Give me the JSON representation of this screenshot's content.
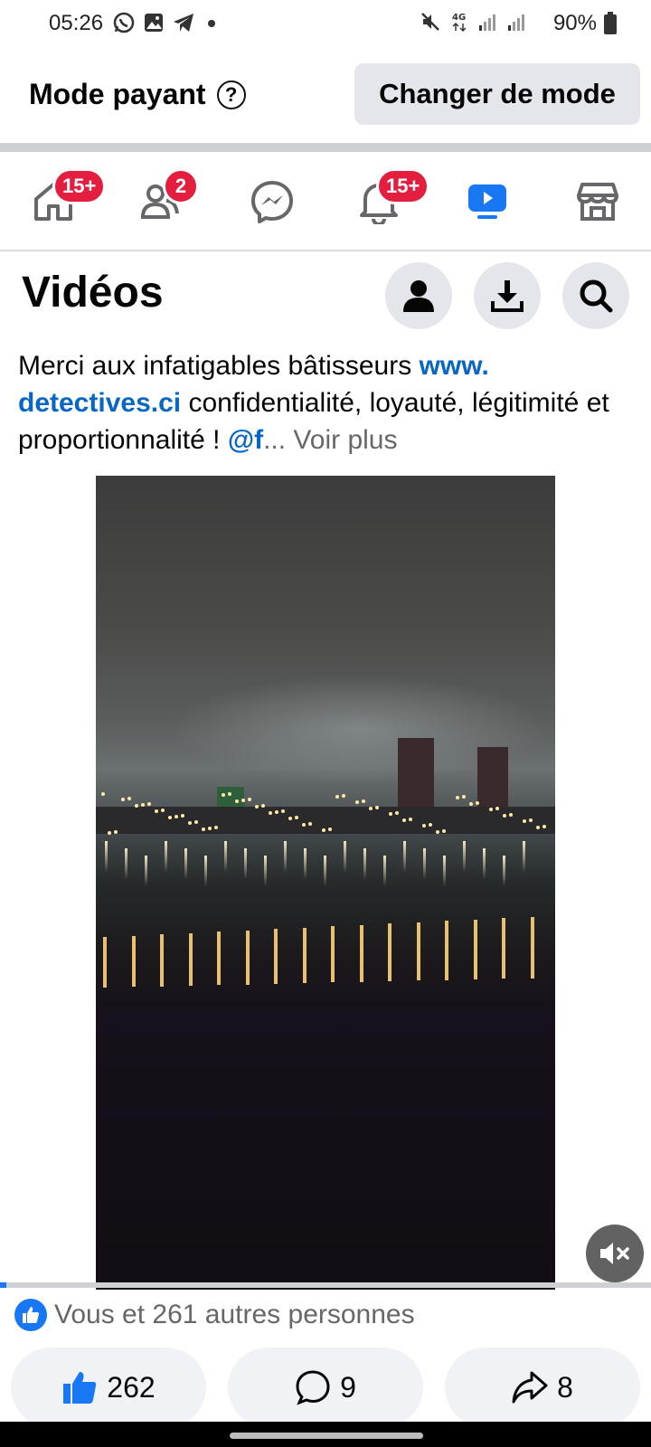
{
  "status_bar": {
    "time": "05:26",
    "battery": "90%",
    "icons_left": [
      "whatsapp-icon",
      "gallery-icon",
      "telegram-icon",
      "dot-icon"
    ],
    "icons_right": [
      "mute-icon",
      "4g-icon",
      "signal-icon",
      "signal-icon"
    ]
  },
  "mode_bar": {
    "title": "Mode payant",
    "help_icon": "?",
    "change_button": "Changer de mode"
  },
  "nav": {
    "home_badge": "15+",
    "friends_badge": "2",
    "notifications_badge": "15+",
    "active": "videos"
  },
  "videos": {
    "title": "Vidéos"
  },
  "post": {
    "caption_part1": "Merci aux infatigables bâtisseurs ",
    "link_1": "www.",
    "link_2": "detectives.ci",
    "caption_part2": "  confidentialité, loyauté, légitimité et proportionnalité  ! ",
    "mention": "@f",
    "ellipsis": "...",
    "see_more": " Voir plus",
    "reactions_text": "Vous et 261 autres personnes",
    "likes": "262",
    "comments": "9",
    "shares": "8",
    "progress": 0.01
  },
  "colors": {
    "accent": "#1877f2",
    "badge": "#e41e3f",
    "link": "#0866c6"
  }
}
